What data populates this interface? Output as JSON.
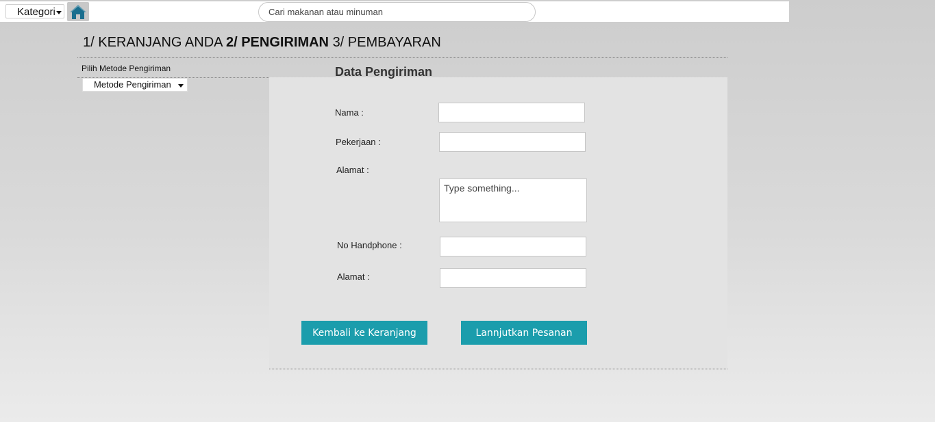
{
  "topbar": {
    "kategori_label": "Kategori",
    "home_icon": "home-icon",
    "search_placeholder": "Cari makanan atau minuman"
  },
  "steps": {
    "step1": "1/ KERANJANG ANDA",
    "step2": "2/ PENGIRIMAN",
    "step3": "3/ PEMBAYARAN",
    "active_step": 2
  },
  "shipping": {
    "label": "Pilih Metode Pengiriman",
    "select_value": "Metode Pengiriman"
  },
  "form": {
    "title": "Data Pengiriman",
    "nama_label": "Nama  :",
    "pekerjaan_label": "Pekerjaan :",
    "alamat_label": "Alamat :",
    "alamat_placeholder": "Type something...",
    "hp_label": "No Handphone :",
    "alamat2_label": "Alamat :"
  },
  "buttons": {
    "back": "Kembali ke Keranjang",
    "continue": "Lannjutkan Pesanan"
  },
  "colors": {
    "accent": "#1b9dac",
    "home_icon": "#1a6e8e"
  }
}
